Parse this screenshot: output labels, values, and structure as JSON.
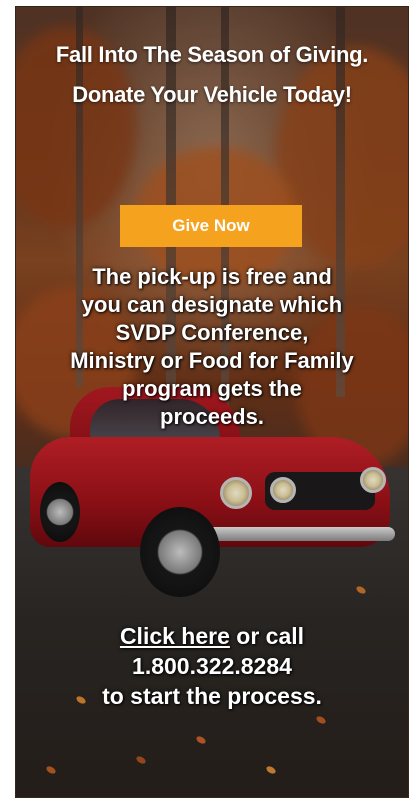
{
  "banner": {
    "headline": [
      "Fall Into The Season of Giving.",
      "Donate Your Vehicle Today!"
    ],
    "button_label": "Give Now",
    "body": [
      "The pick-up is free and",
      "you can designate which",
      "SVDP Conference,",
      "Ministry or Food for Family",
      "program gets the",
      "proceeds."
    ],
    "cta_link": "Click here",
    "cta_after_link": " or call",
    "phone": "1.800.322.8284",
    "cta_end": "to start the process.",
    "button_color": "#f5a21f",
    "car_color": "#c8222a"
  }
}
